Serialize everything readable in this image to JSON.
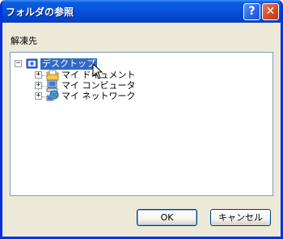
{
  "window": {
    "title": "フォルダの参照",
    "help_label": "?",
    "close_label": "✕"
  },
  "prompt": "解凍先",
  "tree": {
    "root": {
      "label": "デスクトップ",
      "expander": "−",
      "icon": "desktop-icon"
    },
    "children": [
      {
        "label": "マイ ドキュメント",
        "expander": "+",
        "icon": "my-documents-folder-icon"
      },
      {
        "label": "マイ コンピュータ",
        "expander": "+",
        "icon": "my-computer-icon"
      },
      {
        "label": "マイ ネットワーク",
        "expander": "+",
        "icon": "my-network-icon"
      }
    ]
  },
  "buttons": {
    "ok": "OK",
    "cancel": "キャンセル"
  },
  "colors": {
    "titlebar": "#0855dd",
    "selection": "#316ac5",
    "dialog_bg": "#ece9d8"
  }
}
